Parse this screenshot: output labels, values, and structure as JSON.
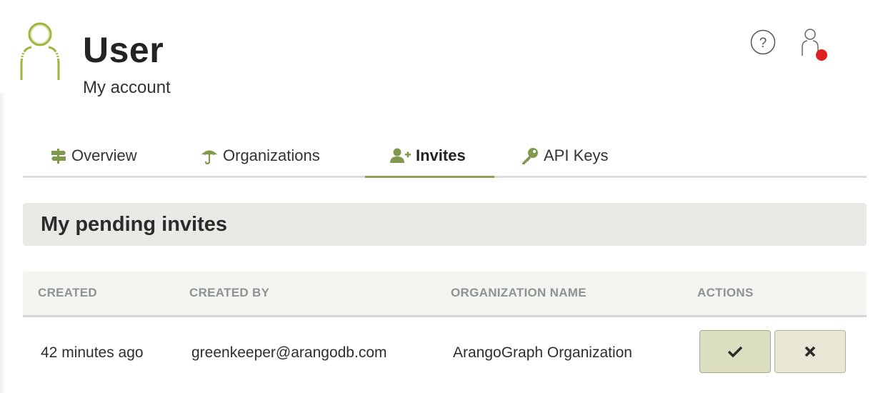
{
  "header": {
    "title": "User",
    "subtitle": "My account",
    "avatar_icon": "user-silhouette-icon",
    "help_icon": "help-circle-icon",
    "user_menu_icon": "user-icon",
    "notification_color": "#e02020"
  },
  "tabs": [
    {
      "label": "Overview",
      "icon": "signpost-icon",
      "active": false
    },
    {
      "label": "Organizations",
      "icon": "umbrella-icon",
      "active": false
    },
    {
      "label": "Invites",
      "icon": "user-plus-icon",
      "active": true
    },
    {
      "label": "API Keys",
      "icon": "key-icon",
      "active": false
    }
  ],
  "section": {
    "title": "My pending invites"
  },
  "table": {
    "columns": [
      "CREATED",
      "CREATED BY",
      "ORGANIZATION NAME",
      "ACTIONS"
    ],
    "rows": [
      {
        "created": "42 minutes ago",
        "created_by": "greenkeeper@arangodb.com",
        "organization_name": "ArangoGraph Organization",
        "actions": [
          "accept-check-icon",
          "decline-x-icon"
        ]
      }
    ]
  },
  "colors": {
    "accent": "#8aa05b",
    "icon_green": "#7f9a4f",
    "avatar_green": "#a2b33b"
  }
}
